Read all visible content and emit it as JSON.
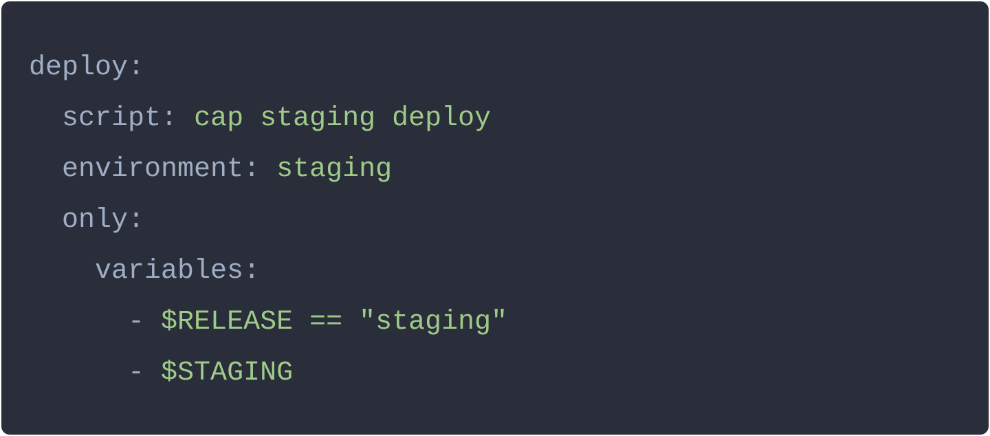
{
  "code": {
    "lines": [
      {
        "indent": 0,
        "key": "deploy",
        "value": null,
        "isDash": false
      },
      {
        "indent": 1,
        "key": "script",
        "value": "cap staging deploy",
        "isDash": false
      },
      {
        "indent": 1,
        "key": "environment",
        "value": "staging",
        "isDash": false
      },
      {
        "indent": 1,
        "key": "only",
        "value": null,
        "isDash": false
      },
      {
        "indent": 2,
        "key": "variables",
        "value": null,
        "isDash": false
      },
      {
        "indent": 3,
        "key": null,
        "value": "$RELEASE == \"staging\"",
        "isDash": true
      },
      {
        "indent": 3,
        "key": null,
        "value": "$STAGING",
        "isDash": true
      }
    ]
  }
}
